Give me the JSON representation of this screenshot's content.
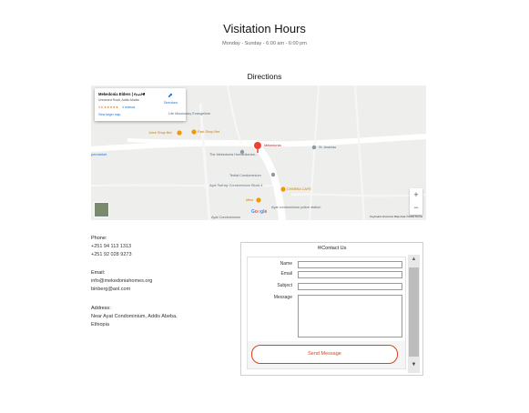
{
  "visitation": {
    "title": "Visitation Hours",
    "hours": "Monday - Sunday - 6:00 am - 6:00 pm"
  },
  "directions": {
    "title": "Directions",
    "map": {
      "place_name": "Mekedonia Elders | የአረጋዊ",
      "place_address": "Unnamed Road, Addis Ababa",
      "rating": "4.6",
      "stars": "★★★★★",
      "reviews_link": "4 reviews",
      "view_larger_link": "View larger map",
      "directions_label": "Directions",
      "directions_icon": "directions-icon",
      "labels": {
        "life_missionary": "Life Missionary Evangelism",
        "juice": "Juice Shop Bet",
        "fast": "Fast Shop Bet",
        "mekedonia_pin": "Mekedonia",
        "st_ananias": "St. Ananias",
        "humanitarian": "The Mekedonia Humanitarian...",
        "permarket": "permarket",
        "tedlat": "Tedlat Condominium",
        "ayat_tsehay": "Ayat Tsehay Condominium Block 4",
        "ayat_police": "Ayat condominium police station",
        "chebra": "CHEBRA CAFE",
        "mesi": "Mesi",
        "ayat_condo": "Ayat Condominium",
        "google": "Google",
        "footer": "Keyboard shortcuts   Map data ©2024   Terms"
      },
      "zoom_in": "+",
      "zoom_out": "−",
      "colors": {
        "pin": "#ea4335",
        "orange": "#f29900",
        "road": "#ffffff",
        "land": "#eeefed"
      }
    }
  },
  "contact_info": {
    "phone_label": "Phone:",
    "phones": [
      "+251 94 113 1313",
      "+251 92 028 9273"
    ],
    "email_label": "Email:",
    "emails": [
      "info@mekedoniahomes.org",
      "binberg@aol.com"
    ],
    "address_label": "Address:",
    "address_lines": [
      "Near Ayat Condominium, Addis Abeba,",
      "Ethiopia"
    ]
  },
  "contact_form": {
    "header": "Contact Us",
    "header_icon": "envelope-icon",
    "fields": {
      "name_label": "Name",
      "email_label": "Email",
      "subject_label": "Subject",
      "message_label": "Message"
    },
    "send_button": "Send Message",
    "accent": "#e0401a"
  }
}
